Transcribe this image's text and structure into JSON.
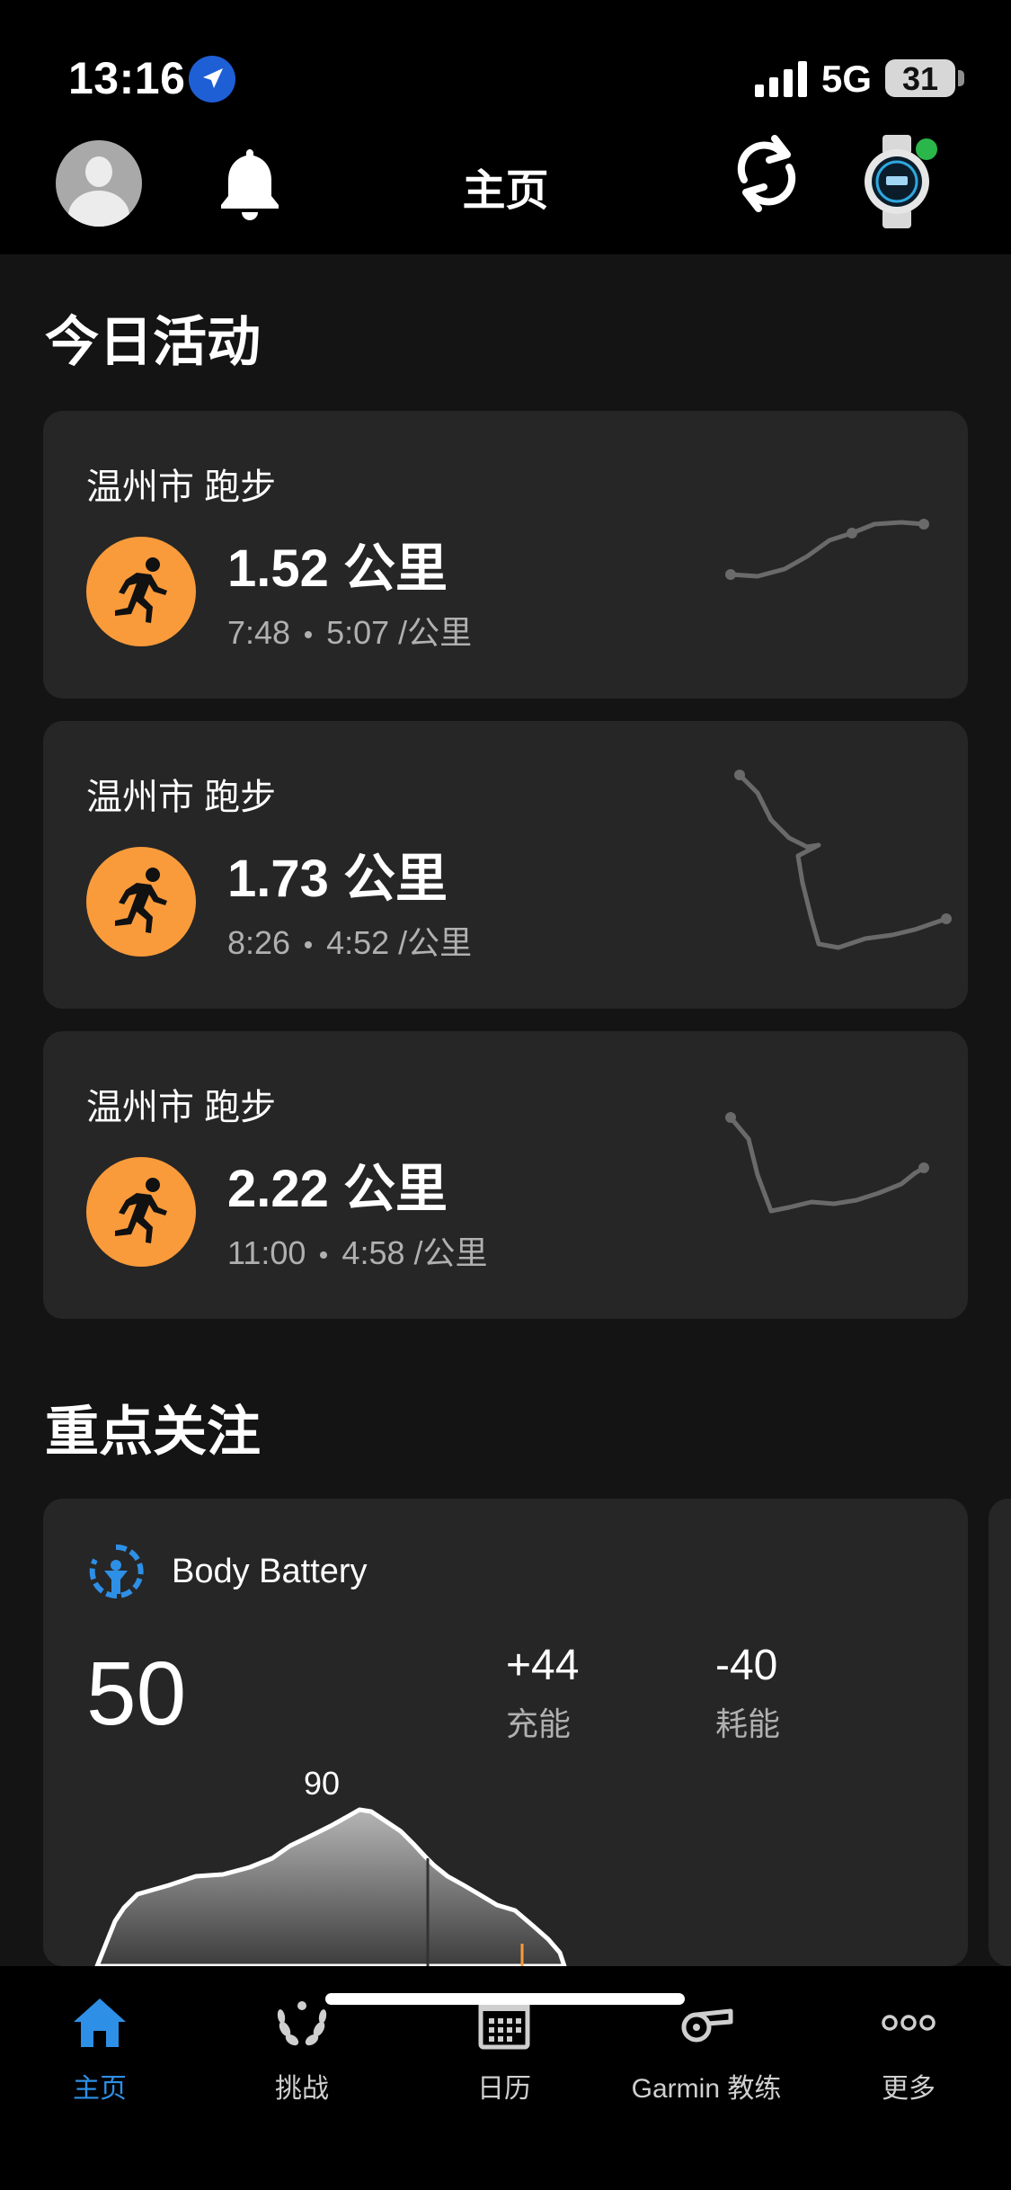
{
  "status_bar": {
    "time": "13:16",
    "network": "5G",
    "battery": "31"
  },
  "header": {
    "title": "主页"
  },
  "today": {
    "section_title": "今日活动",
    "activities": [
      {
        "location": "温州市 跑步",
        "distance": "1.52 公里",
        "duration": "7:48",
        "pace": "5:07 /公里"
      },
      {
        "location": "温州市 跑步",
        "distance": "1.73 公里",
        "duration": "8:26",
        "pace": "4:52 /公里"
      },
      {
        "location": "温州市 跑步",
        "distance": "2.22 公里",
        "duration": "11:00",
        "pace": "4:58 /公里"
      }
    ]
  },
  "highlights": {
    "section_title": "重点关注",
    "body_battery": {
      "title": "Body Battery",
      "value": "50",
      "charged_value": "+44",
      "charged_label": "充能",
      "drained_value": "-40",
      "drained_label": "耗能",
      "peak_label": "90"
    }
  },
  "tabs": [
    {
      "label": "主页",
      "icon": "home-icon",
      "active": true
    },
    {
      "label": "挑战",
      "icon": "laurel-icon",
      "active": false
    },
    {
      "label": "日历",
      "icon": "calendar-icon",
      "active": false
    },
    {
      "label": "Garmin 教练",
      "icon": "whistle-icon",
      "active": false
    },
    {
      "label": "更多",
      "icon": "more-icon",
      "active": false
    }
  ],
  "colors": {
    "accent": "#2e8fe6",
    "run": "#f99b3b",
    "card": "#262626",
    "background": "#141414"
  }
}
